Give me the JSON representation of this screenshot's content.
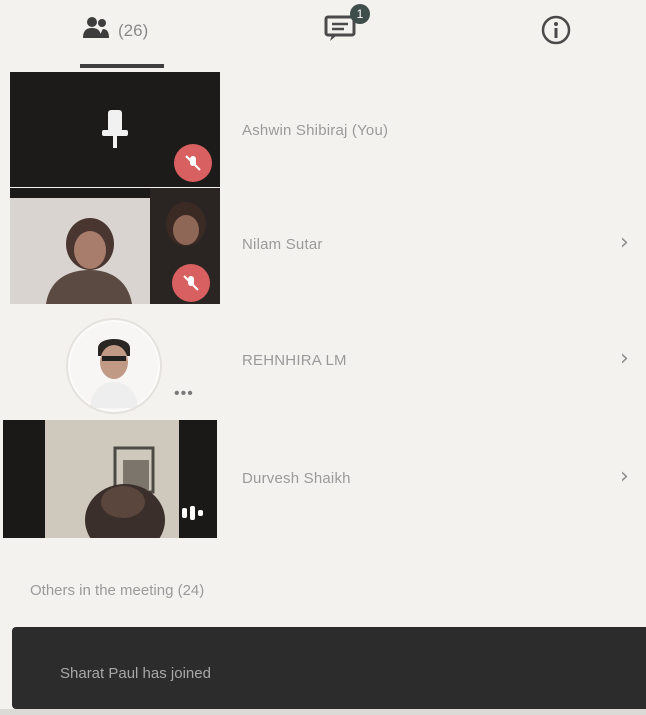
{
  "tabs": {
    "people_count": "(26)",
    "chat_badge": "1"
  },
  "participants": [
    {
      "name": "Ashwin Shibiraj (You)"
    },
    {
      "name": "Nilam Sutar"
    },
    {
      "name": "REHNHIRA LM"
    },
    {
      "name": "Durvesh Shaikh"
    }
  ],
  "ellipsis": "•••",
  "chevron": "›",
  "others_label": "Others in the meeting (24)",
  "toast": {
    "text": "Sharat Paul has joined"
  },
  "colors": {
    "background": "#f4f2ef",
    "toast": "#2c2c2c",
    "mute_badge": "#d96060",
    "tab_indicator": "#3e3e3e"
  },
  "icons": [
    "people-icon",
    "chat-icon",
    "info-icon",
    "mic-off-icon",
    "chevron-right-icon",
    "more-icon"
  ]
}
